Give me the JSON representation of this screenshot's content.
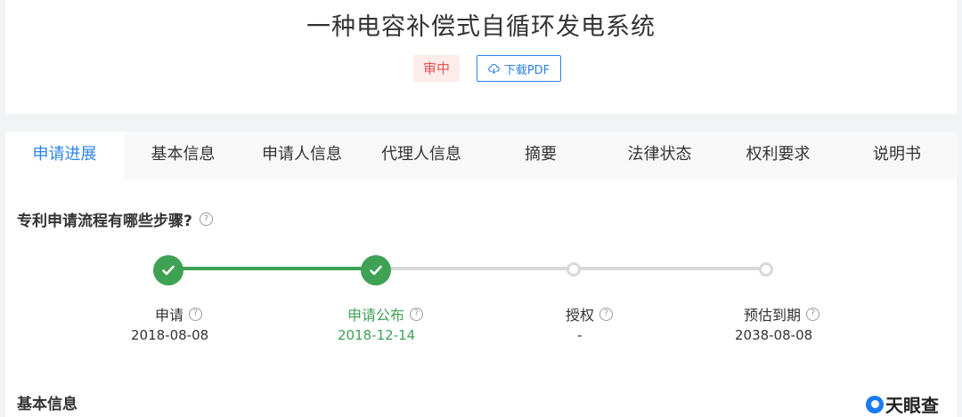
{
  "header": {
    "title": "一种电容补偿式自循环发电系统",
    "status_badge": "审中",
    "download_label": "下载PDF"
  },
  "tabs": [
    {
      "label": "申请进展",
      "active": true
    },
    {
      "label": "基本信息",
      "active": false
    },
    {
      "label": "申请人信息",
      "active": false
    },
    {
      "label": "代理人信息",
      "active": false
    },
    {
      "label": "摘要",
      "active": false
    },
    {
      "label": "法律状态",
      "active": false
    },
    {
      "label": "权利要求",
      "active": false
    },
    {
      "label": "说明书",
      "active": false
    }
  ],
  "progress_section": {
    "title": "专利申请流程有哪些步骤?",
    "steps": [
      {
        "label": "申请",
        "date": "2018-08-08",
        "status": "done"
      },
      {
        "label": "申请公布",
        "date": "2018-12-14",
        "status": "done-current"
      },
      {
        "label": "授权",
        "date": "-",
        "status": "pending"
      },
      {
        "label": "预估到期",
        "date": "2038-08-08",
        "status": "pending"
      }
    ]
  },
  "basic_section": {
    "title": "基本信息"
  },
  "logo_text": "天眼查",
  "colors": {
    "accent": "#2d84e6",
    "done": "#3ea154",
    "badge_bg": "#fdecea",
    "badge_text": "#e55353",
    "pending_line": "#d8d8d8"
  },
  "icons": {
    "download": "cloud-download-icon",
    "help": "question-circle-icon",
    "check": "check-icon"
  }
}
